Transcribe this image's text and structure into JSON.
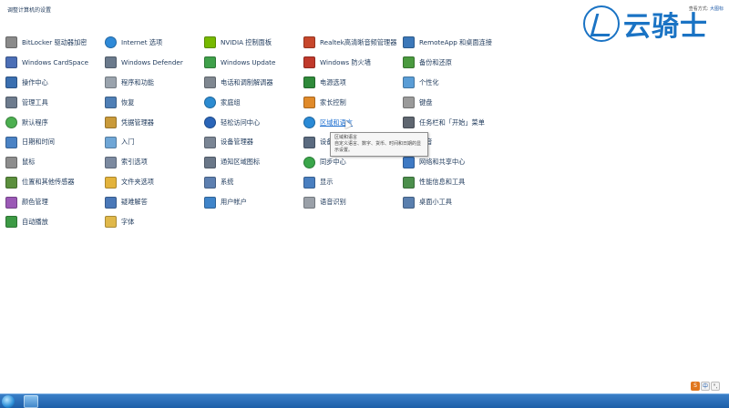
{
  "header": {
    "title": "调整计算机的设置",
    "view_by_label": "查看方式:",
    "view_by_value": "大图标"
  },
  "items": [
    {
      "label": "BitLocker 驱动器加密",
      "color": "#8a8a8a",
      "icon": "key-icon"
    },
    {
      "label": "Internet 选项",
      "color": "#2f8ad8",
      "icon": "globe-icon",
      "round": true
    },
    {
      "label": "NVIDIA 控制面板",
      "color": "#76b900",
      "icon": "nvidia-icon"
    },
    {
      "label": "Realtek高清晰音频管理器",
      "color": "#c7472c",
      "icon": "speaker-icon"
    },
    {
      "label": "RemoteApp 和桌面连接",
      "color": "#3c78b9",
      "icon": "remote-desktop-icon"
    },
    {
      "label": "Windows CardSpace",
      "color": "#4c6fb6",
      "icon": "cardspace-icon"
    },
    {
      "label": "Windows Defender",
      "color": "#6b7a8c",
      "icon": "defender-icon"
    },
    {
      "label": "Windows Update",
      "color": "#3fa04a",
      "icon": "update-icon"
    },
    {
      "label": "Windows 防火墙",
      "color": "#c0392b",
      "icon": "firewall-icon"
    },
    {
      "label": "备份和还原",
      "color": "#4a9a3f",
      "icon": "backup-icon"
    },
    {
      "label": "操作中心",
      "color": "#3b6fb0",
      "icon": "flag-icon"
    },
    {
      "label": "程序和功能",
      "color": "#9aa3ad",
      "icon": "programs-icon"
    },
    {
      "label": "电话和调制解调器",
      "color": "#7f8790",
      "icon": "phone-icon"
    },
    {
      "label": "电源选项",
      "color": "#2f8a3a",
      "icon": "power-icon"
    },
    {
      "label": "个性化",
      "color": "#5a9dd6",
      "icon": "personalize-icon"
    },
    {
      "label": "管理工具",
      "color": "#6d7b8d",
      "icon": "admin-tools-icon"
    },
    {
      "label": "恢复",
      "color": "#4f7fb6",
      "icon": "recovery-icon"
    },
    {
      "label": "家庭组",
      "color": "#2c8bd1",
      "icon": "homegroup-icon",
      "round": true
    },
    {
      "label": "家长控制",
      "color": "#e08a2a",
      "icon": "parental-icon"
    },
    {
      "label": "键盘",
      "color": "#9a9a9a",
      "icon": "keyboard-icon"
    },
    {
      "label": "默认程序",
      "color": "#4caf50",
      "icon": "default-programs-icon",
      "round": true
    },
    {
      "label": "凭据管理器",
      "color": "#c99a3a",
      "icon": "credential-icon"
    },
    {
      "label": "轻松访问中心",
      "color": "#2a65b8",
      "icon": "ease-access-icon",
      "round": true
    },
    {
      "label": "区域和语言",
      "color": "#2a8ad6",
      "icon": "region-icon",
      "round": true,
      "hover": true
    },
    {
      "label": "任务栏和「开始」菜单",
      "color": "#5f6670",
      "icon": "taskbar-icon"
    },
    {
      "label": "日期和时间",
      "color": "#4a82c4",
      "icon": "clock-icon"
    },
    {
      "label": "入门",
      "color": "#6fa6d6",
      "icon": "getting-started-icon"
    },
    {
      "label": "设备管理器",
      "color": "#7a8594",
      "icon": "device-manager-icon"
    },
    {
      "label": "设备和打印机",
      "color": "#5b6b80",
      "icon": "printer-icon"
    },
    {
      "label": "声音",
      "color": "#8a8f96",
      "icon": "sound-icon"
    },
    {
      "label": "鼠标",
      "color": "#8d8d8d",
      "icon": "mouse-icon"
    },
    {
      "label": "索引选项",
      "color": "#7c8aa0",
      "icon": "index-icon"
    },
    {
      "label": "通知区域图标",
      "color": "#6a7788",
      "icon": "notification-icon"
    },
    {
      "label": "同步中心",
      "color": "#3aa64a",
      "icon": "sync-icon",
      "round": true
    },
    {
      "label": "网络和共享中心",
      "color": "#3f7ac4",
      "icon": "network-icon"
    },
    {
      "label": "位置和其他传感器",
      "color": "#5b8f3d",
      "icon": "sensor-icon"
    },
    {
      "label": "文件夹选项",
      "color": "#e3b33c",
      "icon": "folder-icon"
    },
    {
      "label": "系统",
      "color": "#5d7fb0",
      "icon": "system-icon"
    },
    {
      "label": "显示",
      "color": "#4a7fc0",
      "icon": "display-icon"
    },
    {
      "label": "性能信息和工具",
      "color": "#4c8f4c",
      "icon": "performance-icon"
    },
    {
      "label": "颜色管理",
      "color": "#9b59b6",
      "icon": "color-icon"
    },
    {
      "label": "疑难解答",
      "color": "#4a78b8",
      "icon": "troubleshoot-icon"
    },
    {
      "label": "用户帐户",
      "color": "#3f84c9",
      "icon": "user-icon"
    },
    {
      "label": "语音识别",
      "color": "#9aa0a8",
      "icon": "microphone-icon"
    },
    {
      "label": "桌面小工具",
      "color": "#5a7fae",
      "icon": "gadgets-icon"
    },
    {
      "label": "自动播放",
      "color": "#3d9a45",
      "icon": "autoplay-icon"
    },
    {
      "label": "字体",
      "color": "#e0b84a",
      "icon": "font-icon"
    }
  ],
  "tooltip": {
    "title": "区域和语言",
    "body": "自定义语言、数字、货币、时间和日期的显示设置。"
  },
  "watermark": {
    "text": "云骑士"
  },
  "ime": {
    "s": "S",
    "zh": "中",
    "punct": "°,"
  }
}
